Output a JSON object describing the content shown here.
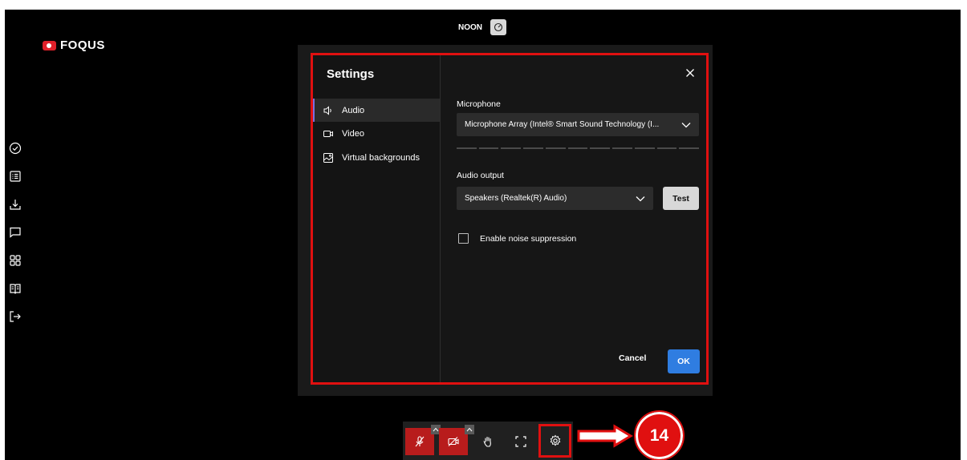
{
  "app": {
    "logo_text": "FOQUS"
  },
  "topbar": {
    "session_label": "NOON"
  },
  "sidebar": {
    "icons": [
      "check-circle-icon",
      "list-icon",
      "download-icon",
      "chat-icon",
      "grid-icon",
      "book-icon",
      "exit-icon"
    ]
  },
  "settings": {
    "title": "Settings",
    "nav": [
      {
        "label": "Audio",
        "icon": "speaker-icon",
        "active": true
      },
      {
        "label": "Video",
        "icon": "video-icon",
        "active": false
      },
      {
        "label": "Virtual backgrounds",
        "icon": "image-icon",
        "active": false
      }
    ],
    "microphone_label": "Microphone",
    "microphone_value": "Microphone Array (Intel® Smart Sound Technology (I...",
    "audio_output_label": "Audio output",
    "audio_output_value": "Speakers (Realtek(R) Audio)",
    "test_label": "Test",
    "noise_suppression_label": "Enable noise suppression",
    "noise_suppression_checked": false,
    "cancel_label": "Cancel",
    "ok_label": "OK"
  },
  "callout": {
    "number": "14"
  },
  "colors": {
    "highlight": "#e01010",
    "primary": "#2f7de1",
    "muted_red": "#b81c1c"
  }
}
